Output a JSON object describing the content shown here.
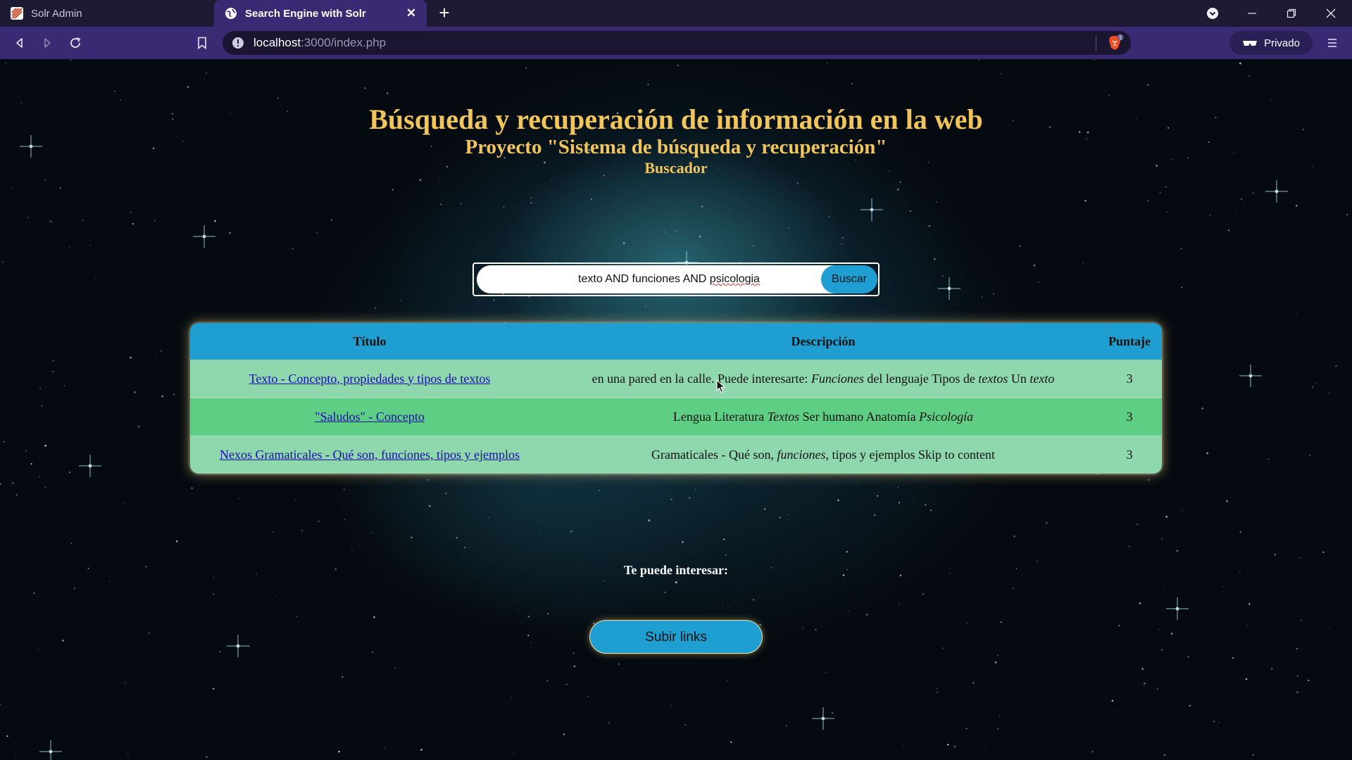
{
  "browser": {
    "tabs": [
      {
        "title": "Solr Admin",
        "icon": "solr-logo-icon",
        "active": false
      },
      {
        "title": "Search Engine with Solr",
        "icon": "globe-icon",
        "active": true
      }
    ],
    "url": {
      "host": "localhost",
      "path": ":3000/index.php"
    },
    "private_label": "Privado",
    "shield_badge": "1"
  },
  "page": {
    "title": "Búsqueda y recuperación de información en la web",
    "subtitle": "Proyecto \"Sistema de búsqueda y recuperación\"",
    "section": "Buscador",
    "search": {
      "query_prefix": "texto AND funciones AND ",
      "query_misspelled": "psicologia",
      "button_label": "Buscar"
    },
    "table": {
      "headers": {
        "title": "Título",
        "description": "Descripción",
        "score": "Puntaje"
      },
      "rows": [
        {
          "title": "Texto - Concepto, propiedades y tipos de textos",
          "desc": [
            {
              "t": "en una pared en la calle. Puede interesarte: ",
              "i": false
            },
            {
              "t": "Funciones",
              "i": true
            },
            {
              "t": " del lenguaje Tipos de ",
              "i": false
            },
            {
              "t": "textos",
              "i": true
            },
            {
              "t": " Un ",
              "i": false
            },
            {
              "t": "texto",
              "i": true
            }
          ],
          "score": "3"
        },
        {
          "title": "\"Saludos\" - Concepto",
          "desc": [
            {
              "t": "Lengua Literatura ",
              "i": false
            },
            {
              "t": "Textos",
              "i": true
            },
            {
              "t": " Ser humano Anatomía ",
              "i": false
            },
            {
              "t": "Psicología",
              "i": true
            }
          ],
          "score": "3"
        },
        {
          "title": "Nexos Gramaticales - Qué son, funciones, tipos y ejemplos",
          "desc": [
            {
              "t": "Gramaticales - Qué son, ",
              "i": false
            },
            {
              "t": "funciones",
              "i": true
            },
            {
              "t": ", tipos y ejemplos Skip to content",
              "i": false
            }
          ],
          "score": "3"
        }
      ]
    },
    "interest_label": "Te puede interesar:",
    "upload_button": "Subir links"
  },
  "colors": {
    "heading_gold": "#f1c55a",
    "accent_blue": "#1f9fd1",
    "row_light_green": "#8fd8ad",
    "row_green": "#5ece84",
    "browser_purple": "#3a2a74"
  }
}
